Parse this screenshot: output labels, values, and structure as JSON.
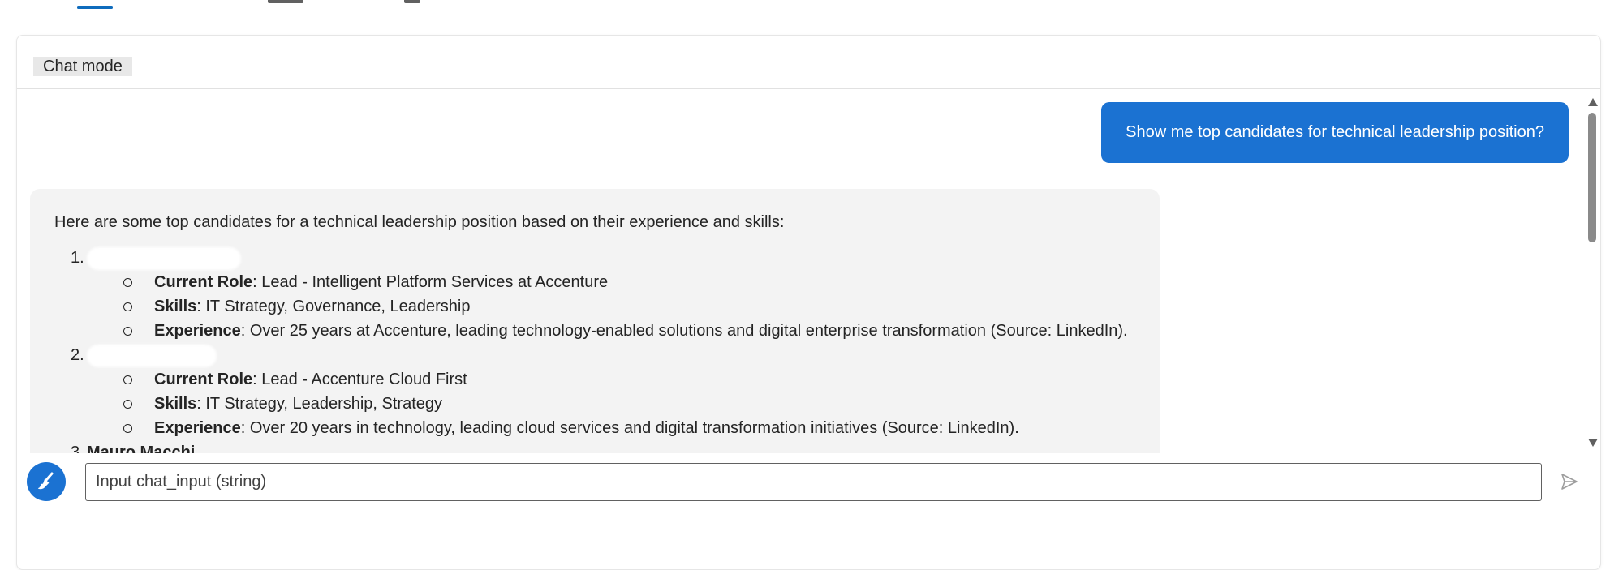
{
  "panel": {
    "mode_label": "Chat mode"
  },
  "chat": {
    "user_message": "Show me top candidates for technical leadership position?",
    "bot_intro": "Here are some top candidates for a technical leadership position based on their experience and skills:",
    "candidates": [
      {
        "number": "1.",
        "details": [
          {
            "label": "Current Role",
            "text": ": Lead - Intelligent Platform Services at Accenture"
          },
          {
            "label": "Skills",
            "text": ": IT Strategy, Governance, Leadership"
          },
          {
            "label": "Experience",
            "text": ": Over 25 years at Accenture, leading technology-enabled solutions and digital enterprise transformation (Source: LinkedIn)."
          }
        ]
      },
      {
        "number": "2.",
        "details": [
          {
            "label": "Current Role",
            "text": ": Lead - Accenture Cloud First"
          },
          {
            "label": "Skills",
            "text": ": IT Strategy, Leadership, Strategy"
          },
          {
            "label": "Experience",
            "text": ": Over 20 years in technology, leading cloud services and digital transformation initiatives (Source: LinkedIn)."
          }
        ]
      },
      {
        "number": "3.",
        "name": "Mauro Macchi"
      }
    ]
  },
  "input": {
    "placeholder": "Input chat_input (string)"
  },
  "colors": {
    "accent": "#1b72d2",
    "bubble_bg": "#f3f3f3"
  },
  "icons": {
    "clear": "broom-icon",
    "send": "send-icon"
  }
}
